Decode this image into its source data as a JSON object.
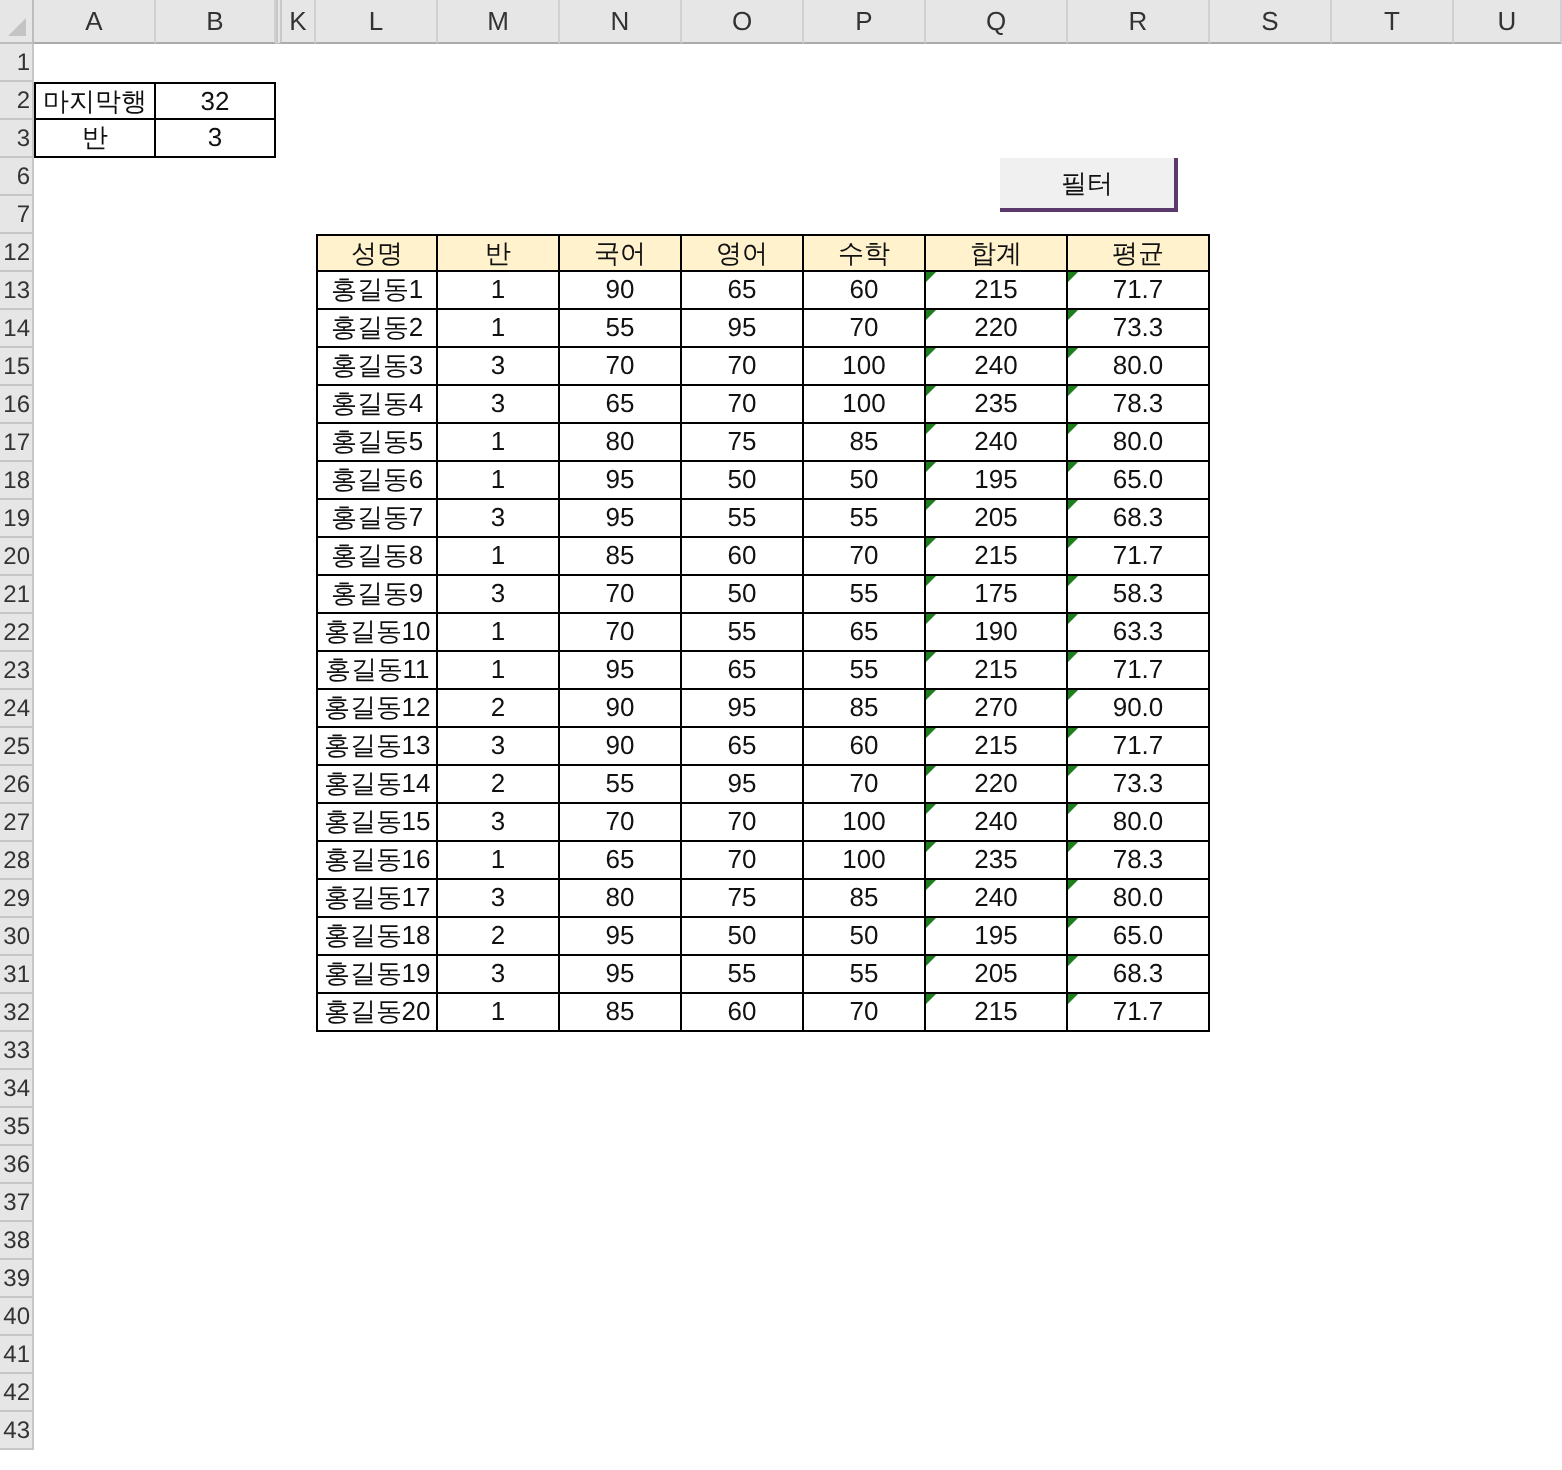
{
  "column_headers": [
    "A",
    "B",
    "K",
    "L",
    "M",
    "N",
    "O",
    "P",
    "Q",
    "R",
    "S",
    "T",
    "U"
  ],
  "row_headers": [
    "1",
    "2",
    "3",
    "6",
    "7",
    "12",
    "13",
    "14",
    "15",
    "16",
    "17",
    "18",
    "19",
    "20",
    "21",
    "22",
    "23",
    "24",
    "25",
    "26",
    "27",
    "28",
    "29",
    "30",
    "31",
    "32",
    "33",
    "34",
    "35",
    "36",
    "37",
    "38",
    "39",
    "40",
    "41",
    "42",
    "43"
  ],
  "summary": [
    {
      "label": "마지막행",
      "value": "32"
    },
    {
      "label": "반",
      "value": "3"
    }
  ],
  "button": {
    "label": "필터"
  },
  "table": {
    "columns": [
      {
        "label": "성명",
        "number_as_text": false
      },
      {
        "label": "반",
        "number_as_text": false
      },
      {
        "label": "국어",
        "number_as_text": false
      },
      {
        "label": "영어",
        "number_as_text": false
      },
      {
        "label": "수학",
        "number_as_text": false
      },
      {
        "label": "합계",
        "number_as_text": true
      },
      {
        "label": "평균",
        "number_as_text": true
      }
    ],
    "rows": [
      [
        "홍길동1",
        "1",
        "90",
        "65",
        "60",
        "215",
        "71.7"
      ],
      [
        "홍길동2",
        "1",
        "55",
        "95",
        "70",
        "220",
        "73.3"
      ],
      [
        "홍길동3",
        "3",
        "70",
        "70",
        "100",
        "240",
        "80.0"
      ],
      [
        "홍길동4",
        "3",
        "65",
        "70",
        "100",
        "235",
        "78.3"
      ],
      [
        "홍길동5",
        "1",
        "80",
        "75",
        "85",
        "240",
        "80.0"
      ],
      [
        "홍길동6",
        "1",
        "95",
        "50",
        "50",
        "195",
        "65.0"
      ],
      [
        "홍길동7",
        "3",
        "95",
        "55",
        "55",
        "205",
        "68.3"
      ],
      [
        "홍길동8",
        "1",
        "85",
        "60",
        "70",
        "215",
        "71.7"
      ],
      [
        "홍길동9",
        "3",
        "70",
        "50",
        "55",
        "175",
        "58.3"
      ],
      [
        "홍길동10",
        "1",
        "70",
        "55",
        "65",
        "190",
        "63.3"
      ],
      [
        "홍길동11",
        "1",
        "95",
        "65",
        "55",
        "215",
        "71.7"
      ],
      [
        "홍길동12",
        "2",
        "90",
        "95",
        "85",
        "270",
        "90.0"
      ],
      [
        "홍길동13",
        "3",
        "90",
        "65",
        "60",
        "215",
        "71.7"
      ],
      [
        "홍길동14",
        "2",
        "55",
        "95",
        "70",
        "220",
        "73.3"
      ],
      [
        "홍길동15",
        "3",
        "70",
        "70",
        "100",
        "240",
        "80.0"
      ],
      [
        "홍길동16",
        "1",
        "65",
        "70",
        "100",
        "235",
        "78.3"
      ],
      [
        "홍길동17",
        "3",
        "80",
        "75",
        "85",
        "240",
        "80.0"
      ],
      [
        "홍길동18",
        "2",
        "95",
        "50",
        "50",
        "195",
        "65.0"
      ],
      [
        "홍길동19",
        "3",
        "95",
        "55",
        "55",
        "205",
        "68.3"
      ],
      [
        "홍길동20",
        "1",
        "85",
        "60",
        "70",
        "215",
        "71.7"
      ]
    ]
  }
}
